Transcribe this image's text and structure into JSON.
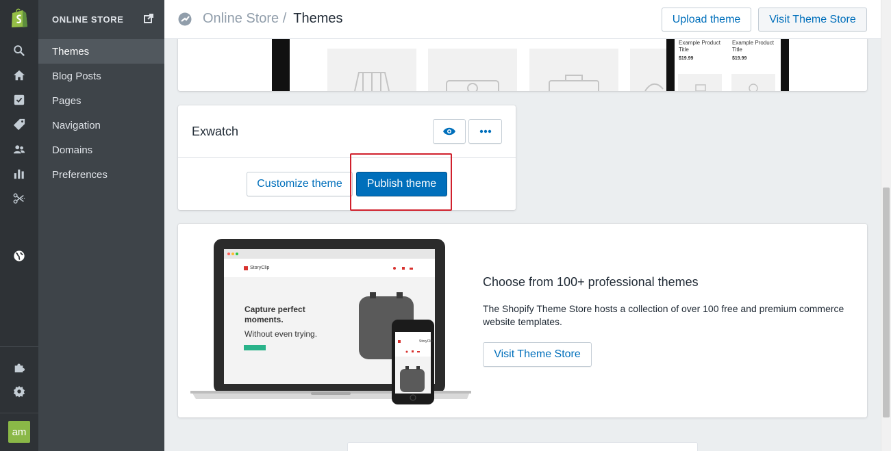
{
  "rail": {
    "icons": [
      "shopify-logo",
      "search-icon",
      "home-icon",
      "orders-icon",
      "tag-icon",
      "customers-icon",
      "analytics-icon",
      "discounts-icon",
      "globe-icon",
      "apps-icon",
      "settings-icon"
    ],
    "avatar_initials": "am"
  },
  "sidebar": {
    "heading": "ONLINE STORE",
    "items": [
      {
        "label": "Themes",
        "active": true
      },
      {
        "label": "Blog Posts"
      },
      {
        "label": "Pages"
      },
      {
        "label": "Navigation"
      },
      {
        "label": "Domains"
      },
      {
        "label": "Preferences"
      }
    ]
  },
  "header": {
    "crumb_parent": "Online Store /",
    "crumb_current": "Themes",
    "upload_label": "Upload theme",
    "visit_label": "Visit Theme Store"
  },
  "preview": {
    "product_title_1": "Example Product Title",
    "product_price_1": "$19.99",
    "product_title_2": "Example Product Title",
    "product_price_2": "$19.99"
  },
  "theme_card": {
    "name": "Exwatch",
    "customize_label": "Customize theme",
    "publish_label": "Publish theme"
  },
  "promo": {
    "title": "Choose from 100+ professional themes",
    "text": "The Shopify Theme Store hosts a collection of over 100 free and premium commerce website templates.",
    "button_label": "Visit Theme Store",
    "illustration": {
      "brand": "StoryClip",
      "headline": "Capture perfect moments.",
      "subline": "Without even trying."
    }
  },
  "colors": {
    "accent": "#006fbb",
    "rail_bg": "#2e3236",
    "sidebar_bg": "#3e4449",
    "highlight": "#d0202c",
    "avatar": "#8ab847"
  }
}
